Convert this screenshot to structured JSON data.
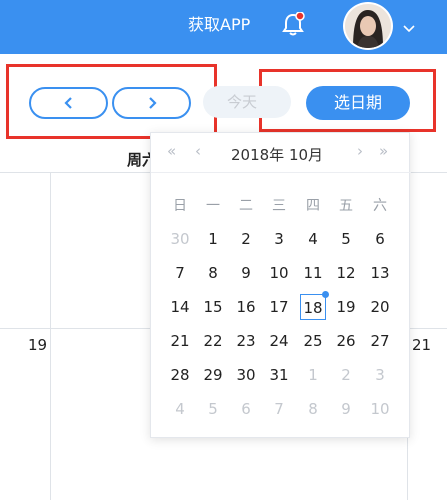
{
  "header": {
    "get_app_label": "获取APP",
    "bell_icon": "bell-icon",
    "avatar": "user-avatar",
    "caret_icon": "chevron-down-icon"
  },
  "toolbar": {
    "prev_icon": "chevron-left-icon",
    "next_icon": "chevron-right-icon",
    "today_label": "今天",
    "pick_date_label": "选日期"
  },
  "calendar_bg": {
    "weekday_fragment": "周六",
    "left_date": "19",
    "right_date": "21"
  },
  "datepicker": {
    "prev_year": "«",
    "prev_month": "‹",
    "next_month": "›",
    "next_year": "»",
    "year_month": "2018年 10月",
    "weekdays": [
      "日",
      "一",
      "二",
      "三",
      "四",
      "五",
      "六"
    ],
    "weeks": [
      [
        "30",
        "1",
        "2",
        "3",
        "4",
        "5",
        "6"
      ],
      [
        "7",
        "8",
        "9",
        "10",
        "11",
        "12",
        "13"
      ],
      [
        "14",
        "15",
        "16",
        "17",
        "18",
        "19",
        "20"
      ],
      [
        "21",
        "22",
        "23",
        "24",
        "25",
        "26",
        "27"
      ],
      [
        "28",
        "29",
        "30",
        "31",
        "1",
        "2",
        "3"
      ],
      [
        "4",
        "5",
        "6",
        "7",
        "8",
        "9",
        "10"
      ]
    ],
    "selected_day": "18"
  },
  "colors": {
    "brand": "#3a90f0",
    "highlight": "#e8332a",
    "notification": "#e8332a"
  }
}
